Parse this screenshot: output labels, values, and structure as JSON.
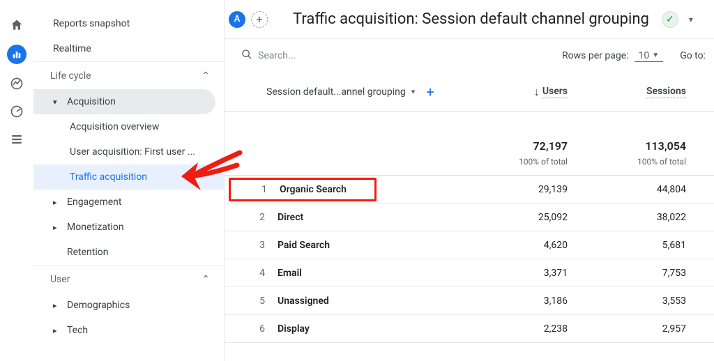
{
  "sidebar": {
    "top_items": [
      "Reports snapshot",
      "Realtime"
    ],
    "sections": [
      {
        "label": "Life cycle",
        "subs": [
          {
            "label": "Acquisition",
            "items": [
              "Acquisition overview",
              "User acquisition: First user ...",
              "Traffic acquisition"
            ],
            "active_index": 2
          },
          {
            "label": "Engagement"
          },
          {
            "label": "Monetization"
          },
          {
            "label": "Retention",
            "no_arrow": true
          }
        ]
      },
      {
        "label": "User",
        "subs": [
          {
            "label": "Demographics"
          },
          {
            "label": "Tech"
          }
        ]
      }
    ]
  },
  "header": {
    "badge": "A",
    "title": "Traffic acquisition: Session default channel grouping"
  },
  "controls": {
    "search_placeholder": "Search...",
    "rows_per_page_label": "Rows per page:",
    "rows_per_page_value": "10",
    "goto_label": "Go to:"
  },
  "table": {
    "dimension_label": "Session default...annel grouping",
    "col_users": "Users",
    "col_sessions": "Sessions",
    "totals": {
      "users": "72,197",
      "sessions": "113,054",
      "users_sub": "100% of total",
      "sessions_sub": "100% of total"
    },
    "rows": [
      {
        "n": "1",
        "name": "Organic Search",
        "users": "29,139",
        "sessions": "44,804",
        "highlight": true
      },
      {
        "n": "2",
        "name": "Direct",
        "users": "25,092",
        "sessions": "38,022"
      },
      {
        "n": "3",
        "name": "Paid Search",
        "users": "4,620",
        "sessions": "5,681"
      },
      {
        "n": "4",
        "name": "Email",
        "users": "3,371",
        "sessions": "7,753"
      },
      {
        "n": "5",
        "name": "Unassigned",
        "users": "3,186",
        "sessions": "3,553"
      },
      {
        "n": "6",
        "name": "Display",
        "users": "2,238",
        "sessions": "2,957"
      }
    ]
  }
}
